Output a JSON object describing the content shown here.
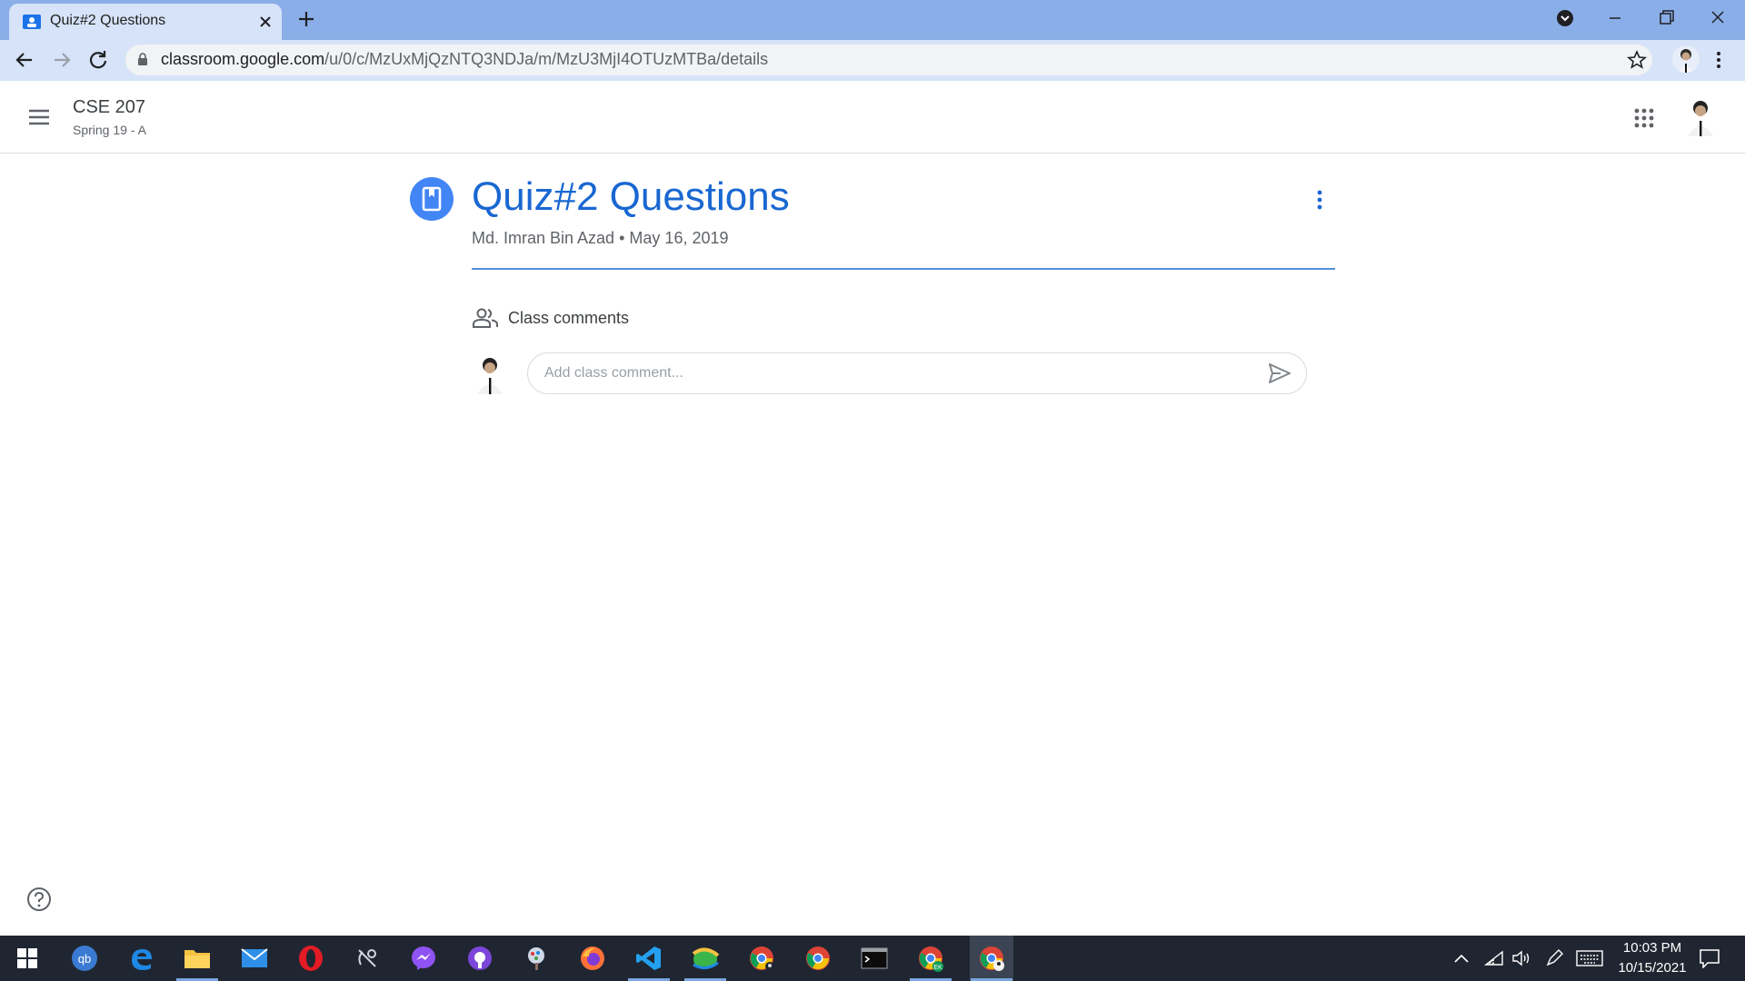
{
  "browser": {
    "tab_title": "Quiz#2 Questions",
    "url_host": "classroom.google.com",
    "url_path": "/u/0/c/MzUxMjQzNTQ3NDJa/m/MzU3MjI4OTUzMTBa/details"
  },
  "header": {
    "class_name": "CSE 207",
    "class_section": "Spring 19 - A"
  },
  "assignment": {
    "title": "Quiz#2 Questions",
    "author": "Md. Imran Bin Azad",
    "separator": "•",
    "date": "May 16, 2019"
  },
  "comments": {
    "heading": "Class comments",
    "placeholder": "Add class comment..."
  },
  "taskbar": {
    "time": "10:03 PM",
    "date": "10/15/2021"
  },
  "colors": {
    "tab_strip": "#8aaee8",
    "accent": "#1967d2",
    "taskbar": "#202631"
  },
  "icons": [
    "classroom-favicon",
    "close-icon",
    "plus-icon",
    "minimize-icon",
    "restore-icon",
    "back-icon",
    "forward-icon",
    "reload-icon",
    "lock-icon",
    "star-icon",
    "menu-icon",
    "apps-grid-icon",
    "assignment-icon",
    "more-vert-icon",
    "people-icon",
    "send-icon",
    "help-icon"
  ]
}
